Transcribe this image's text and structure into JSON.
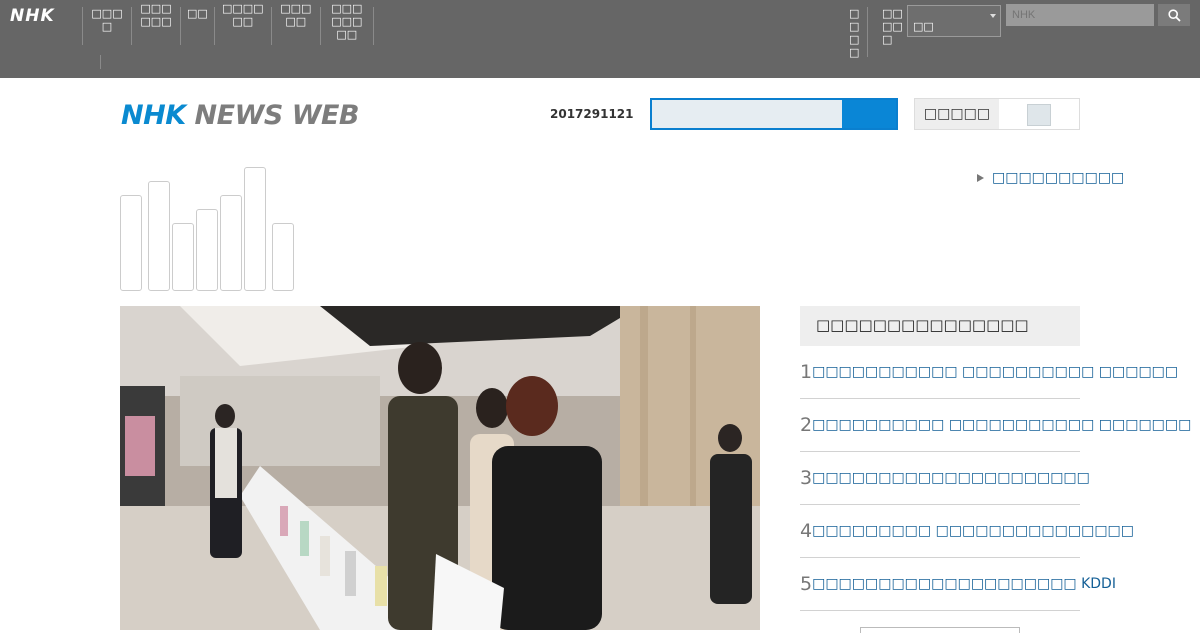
{
  "topbar": {
    "logo": "NHK",
    "nav": [
      {
        "label": "□□□□"
      },
      {
        "label": "□□□□□□"
      },
      {
        "label": "□□"
      },
      {
        "label": "□□□□□□"
      },
      {
        "label": "□□□□□"
      },
      {
        "label": "□□□□□□□□"
      }
    ],
    "right_nav": [
      {
        "label": "□□□□"
      },
      {
        "label": "□□□□□"
      }
    ],
    "region": "□□",
    "search_placeholder": "NHK",
    "search_icon": "search-icon"
  },
  "header": {
    "brand_nhk": "NHK",
    "brand_rest": "NEWS WEB",
    "date": "2017291121",
    "search_value": "",
    "font_toggle_label": "□□□□□"
  },
  "categories": {
    "link": "□□□□□□□□□□"
  },
  "ranking": {
    "title": "□□□□□□□□□□□□□□□",
    "items": [
      {
        "num": "1",
        "title": "□□□□□□□□□□□ □□□□□□□□□□ □□□□□□"
      },
      {
        "num": "2",
        "title": "□□□□□□□□□□ □□□□□□□□□□□ □□□□□□□"
      },
      {
        "num": "3",
        "title": "□□□□□□□□□□□□□□□□□□□□□"
      },
      {
        "num": "4",
        "title": "□□□□□□□□□ □□□□□□□□□□□□□□□"
      },
      {
        "num": "5",
        "title": "□□□□□□□□□□□□□□□□□□□□ KDDI"
      }
    ]
  }
}
